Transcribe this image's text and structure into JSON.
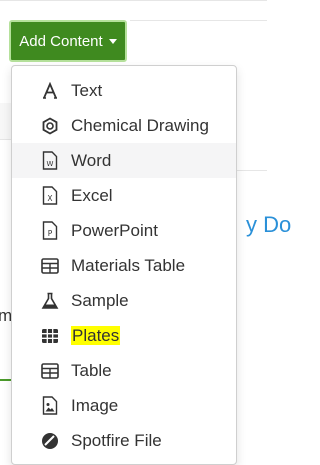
{
  "toolbar": {
    "add_content_label": "Add Content"
  },
  "background": {
    "right_text": "y Do",
    "left_text": "m"
  },
  "menu": {
    "items": [
      {
        "label": "Text",
        "icon": "text-a-icon"
      },
      {
        "label": "Chemical Drawing",
        "icon": "chemical-drawing-icon"
      },
      {
        "label": "Word",
        "icon": "word-file-icon"
      },
      {
        "label": "Excel",
        "icon": "excel-file-icon"
      },
      {
        "label": "PowerPoint",
        "icon": "powerpoint-file-icon"
      },
      {
        "label": "Materials Table",
        "icon": "materials-table-icon"
      },
      {
        "label": "Sample",
        "icon": "sample-flask-icon"
      },
      {
        "label": "Plates",
        "icon": "plates-grid-icon",
        "highlighted": true
      },
      {
        "label": "Table",
        "icon": "table-icon"
      },
      {
        "label": "Image",
        "icon": "image-icon"
      },
      {
        "label": "Spotfire File",
        "icon": "spotfire-icon"
      }
    ]
  },
  "colors": {
    "button_bg": "#3f8a1f",
    "button_border": "#b5e19b",
    "highlight": "#ffff00",
    "link_blue": "#2a90d8"
  }
}
